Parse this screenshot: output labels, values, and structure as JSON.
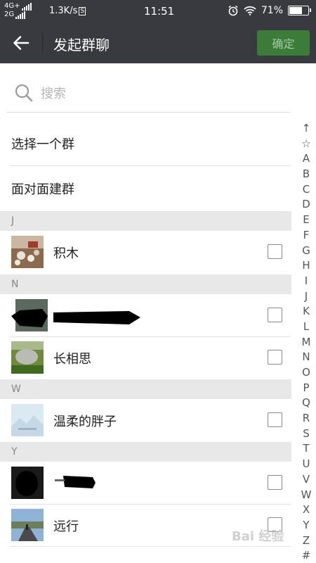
{
  "status_bar": {
    "network_top": "4G+",
    "network_bottom": "2G",
    "speed": "1.3K/s",
    "speed_badge": "S",
    "time": "11:51",
    "battery_text": "71%",
    "battery_level": 0.71
  },
  "header": {
    "title": "发起群聊",
    "confirm_label": "确定"
  },
  "search": {
    "placeholder": "搜索"
  },
  "options": {
    "select_group": "选择一个群",
    "face_to_face": "面对面建群"
  },
  "sections": [
    {
      "letter": "J",
      "contacts": [
        {
          "name": "积木"
        }
      ]
    },
    {
      "letter": "N",
      "contacts": [
        {
          "name": ""
        },
        {
          "name": "长相思"
        }
      ]
    },
    {
      "letter": "W",
      "contacts": [
        {
          "name": "温柔的胖子"
        }
      ]
    },
    {
      "letter": "Y",
      "contacts": [
        {
          "name": ""
        },
        {
          "name": "远行"
        }
      ]
    }
  ],
  "index_letters": [
    "↑",
    "☆",
    "A",
    "B",
    "C",
    "D",
    "E",
    "F",
    "G",
    "H",
    "I",
    "J",
    "K",
    "L",
    "M",
    "N",
    "O",
    "P",
    "Q",
    "R",
    "S",
    "T",
    "U",
    "V",
    "W",
    "X",
    "Y",
    "Z",
    "#"
  ],
  "watermark": "Bai 经验",
  "colors": {
    "header_bg": "#393a3f",
    "confirm_bg": "#3a7c38",
    "section_bg": "#e8e8e8"
  }
}
